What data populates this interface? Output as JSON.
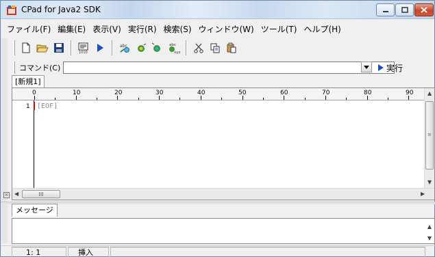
{
  "window": {
    "title": "CPad for Java2 SDK",
    "controls": {
      "minimize": "minimize",
      "maximize": "maximize",
      "close": "close"
    }
  },
  "menu": [
    {
      "label": "ファイル(F)"
    },
    {
      "label": "編集(E)"
    },
    {
      "label": "表示(V)"
    },
    {
      "label": "実行(R)"
    },
    {
      "label": "検索(S)"
    },
    {
      "label": "ウィンドウ(W)"
    },
    {
      "label": "ツール(T)"
    },
    {
      "label": "ヘルプ(H)"
    }
  ],
  "toolbar": {
    "buttons": [
      {
        "name": "new-file-icon"
      },
      {
        "name": "open-folder-icon"
      },
      {
        "name": "save-icon"
      },
      {
        "name": "compile-icon"
      },
      {
        "name": "run-icon"
      },
      {
        "name": "find-icon"
      },
      {
        "name": "find-next-icon"
      },
      {
        "name": "find-prev-icon"
      },
      {
        "name": "replace-icon"
      },
      {
        "name": "cut-icon"
      },
      {
        "name": "copy-icon"
      },
      {
        "name": "paste-icon"
      }
    ]
  },
  "command": {
    "label": "コマンド(C)",
    "value": "",
    "run_label": "実行"
  },
  "editor_tab": {
    "label": "[新規1]"
  },
  "ruler": {
    "marks": [
      "0",
      "10",
      "20",
      "30",
      "40",
      "50",
      "60",
      "70",
      "80",
      "90"
    ]
  },
  "editor": {
    "line_number": "1",
    "eof_marker": "[EOF]",
    "hscroll_grip": "III"
  },
  "message_tab": {
    "label": "メッセージ"
  },
  "status": {
    "position": "1:  1",
    "mode": "挿入"
  },
  "colors": {
    "titlebar": "#cfe0f2",
    "close_button": "#c9462c",
    "eof_text": "#8a8a8a",
    "cursor": "#dd0000"
  }
}
